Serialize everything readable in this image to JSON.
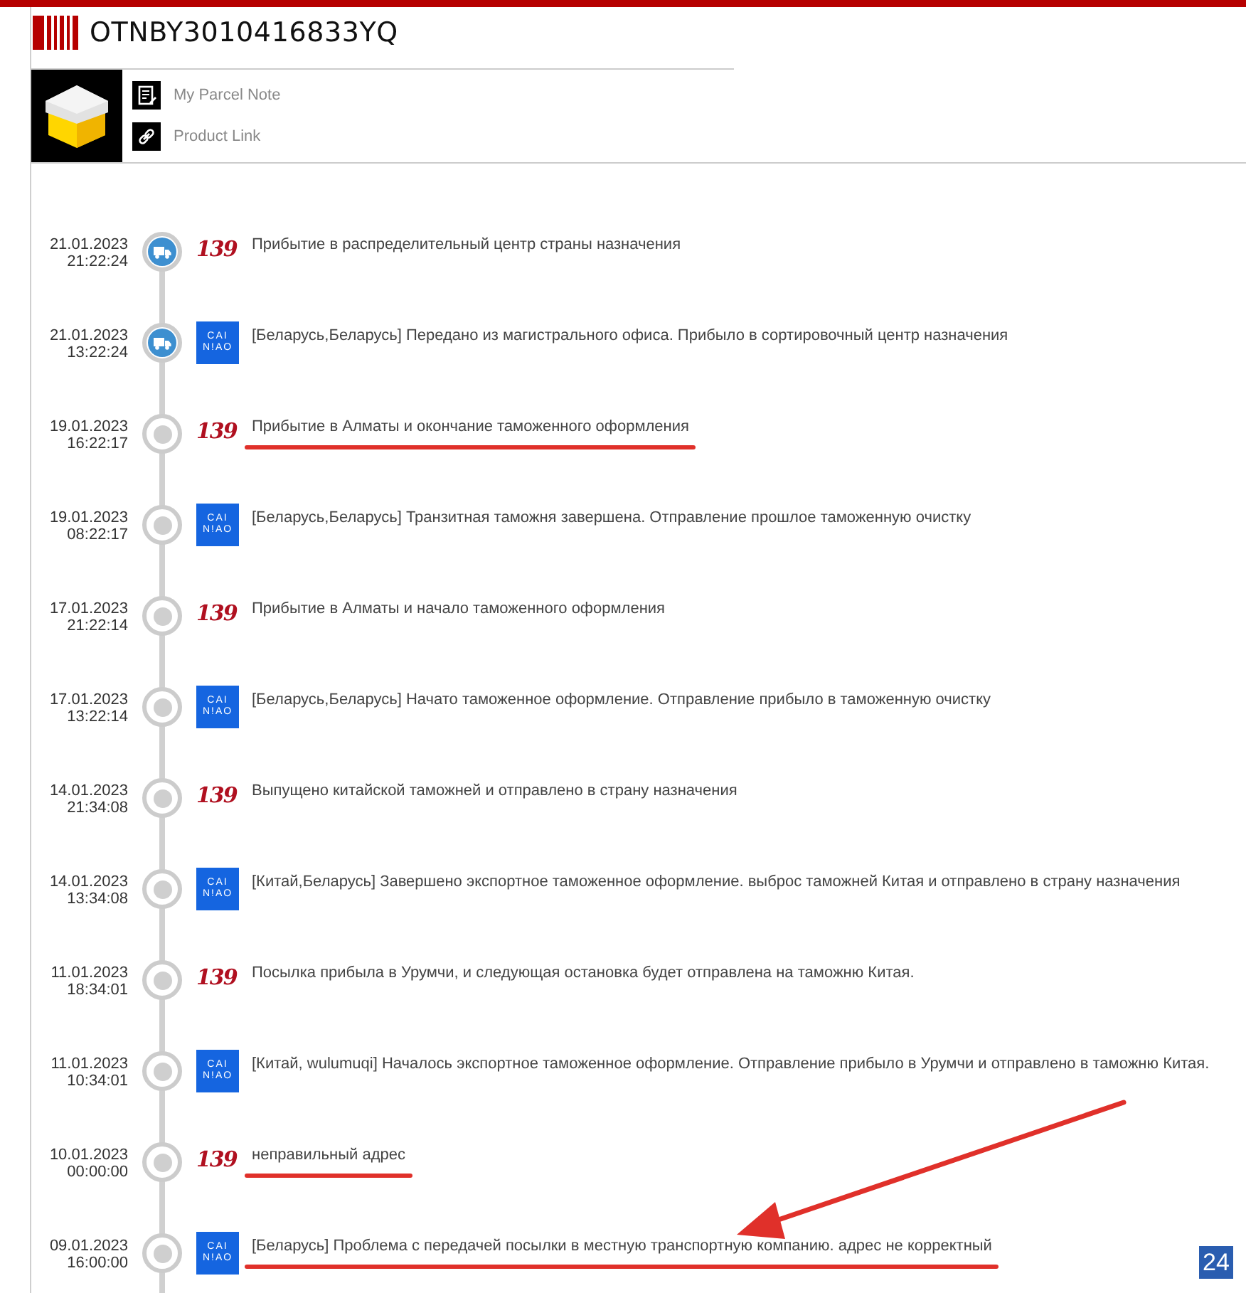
{
  "tracking_number": "OTNBY3010416833YQ",
  "parcel_links": [
    {
      "kind": "note",
      "label": "My Parcel Note"
    },
    {
      "kind": "link",
      "label": "Product Link"
    }
  ],
  "events": [
    {
      "date": "21.01.2023",
      "time": "21:22:24",
      "in_transit": true,
      "carrier": {
        "kind": "red_italic",
        "lines": [
          "139"
        ]
      },
      "text": "Прибытие в распределительный центр страны назначения",
      "underlined": false
    },
    {
      "date": "21.01.2023",
      "time": "13:22:24",
      "in_transit": true,
      "carrier": {
        "kind": "blue_tile",
        "lines": [
          "CAI",
          "N!AO"
        ]
      },
      "text": "[Беларусь,Беларусь] Передано из магистрального офиса. Прибыло в сортировочный центр назначения",
      "underlined": false
    },
    {
      "date": "19.01.2023",
      "time": "16:22:17",
      "in_transit": false,
      "carrier": {
        "kind": "red_italic",
        "lines": [
          "139"
        ]
      },
      "text": "Прибытие в Алматы и окончание таможенного оформления",
      "underlined": true
    },
    {
      "date": "19.01.2023",
      "time": "08:22:17",
      "in_transit": false,
      "carrier": {
        "kind": "blue_tile",
        "lines": [
          "CAI",
          "N!AO"
        ]
      },
      "text": "[Беларусь,Беларусь] Транзитная таможня завершена. Отправление прошлое таможенную очистку",
      "underlined": false
    },
    {
      "date": "17.01.2023",
      "time": "21:22:14",
      "in_transit": false,
      "carrier": {
        "kind": "red_italic",
        "lines": [
          "139"
        ]
      },
      "text": "Прибытие в Алматы и начало таможенного оформления",
      "underlined": false
    },
    {
      "date": "17.01.2023",
      "time": "13:22:14",
      "in_transit": false,
      "carrier": {
        "kind": "blue_tile",
        "lines": [
          "CAI",
          "N!AO"
        ]
      },
      "text": "[Беларусь,Беларусь] Начато таможенное оформление. Отправление прибыло в таможенную очистку",
      "underlined": false
    },
    {
      "date": "14.01.2023",
      "time": "21:34:08",
      "in_transit": false,
      "carrier": {
        "kind": "red_italic",
        "lines": [
          "139"
        ]
      },
      "text": "Выпущено китайской таможней и отправлено в страну назначения",
      "underlined": false
    },
    {
      "date": "14.01.2023",
      "time": "13:34:08",
      "in_transit": false,
      "carrier": {
        "kind": "blue_tile",
        "lines": [
          "CAI",
          "N!AO"
        ]
      },
      "text": "[Китай,Беларусь] Завершено экспортное таможенное оформление. выброс таможней Китая и отправлено в страну назначения",
      "underlined": false
    },
    {
      "date": "11.01.2023",
      "time": "18:34:01",
      "in_transit": false,
      "carrier": {
        "kind": "red_italic",
        "lines": [
          "139"
        ]
      },
      "text": "Посылка прибыла в Урумчи, и следующая остановка будет отправлена на таможню Китая.",
      "underlined": false
    },
    {
      "date": "11.01.2023",
      "time": "10:34:01",
      "in_transit": false,
      "carrier": {
        "kind": "blue_tile",
        "lines": [
          "CAI",
          "N!AO"
        ]
      },
      "text": "[Китай, wulumuqi] Началось экспортное таможенное оформление. Отправление прибыло в Урумчи и отправлено в таможню Китая.",
      "underlined": false
    },
    {
      "date": "10.01.2023",
      "time": "00:00:00",
      "in_transit": false,
      "carrier": {
        "kind": "red_italic",
        "lines": [
          "139"
        ]
      },
      "text": "неправильный адрес",
      "underlined": true
    },
    {
      "date": "09.01.2023",
      "time": "16:00:00",
      "in_transit": false,
      "carrier": {
        "kind": "blue_tile",
        "lines": [
          "CAI",
          "N!AO"
        ]
      },
      "text": "[Беларусь] Проблема с передачей посылки в местную транспортную компанию. адрес не корректный",
      "underlined": true
    }
  ],
  "annotation_arrow": true,
  "page_badge": "24"
}
